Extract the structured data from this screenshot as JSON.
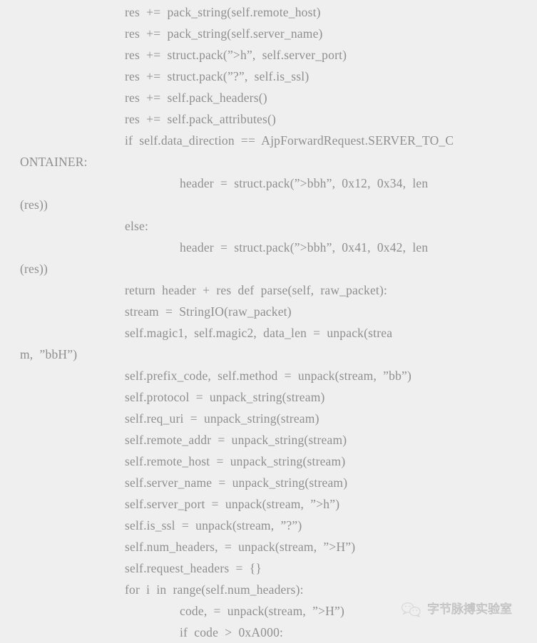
{
  "page": {
    "background_color": "#efefef",
    "text_color": "#8f8f8f",
    "kind": "code-screenshot",
    "language": "python"
  },
  "code": {
    "lines": [
      {
        "indent": 1,
        "text": "res  +=  pack_string(self.remote_host)"
      },
      {
        "indent": 1,
        "text": "res  +=  pack_string(self.server_name)"
      },
      {
        "indent": 1,
        "text": "res  +=  struct.pack(”>h”,  self.server_port)"
      },
      {
        "indent": 1,
        "text": "res  +=  struct.pack(”?”,  self.is_ssl)"
      },
      {
        "indent": 1,
        "text": "res  +=  self.pack_headers()"
      },
      {
        "indent": 1,
        "text": "res  +=  self.pack_attributes()"
      },
      {
        "indent": 1,
        "text": "if  self.data_direction  ==  AjpForwardRequest.SERVER_TO_C"
      },
      {
        "indent": 0,
        "text": "ONTAINER:"
      },
      {
        "indent": 2,
        "text": "header  =  struct.pack(”>bbh”,  0x12,  0x34,  len"
      },
      {
        "indent": 0,
        "text": "(res))"
      },
      {
        "indent": 1,
        "text": "else:"
      },
      {
        "indent": 2,
        "text": "header  =  struct.pack(”>bbh”,  0x41,  0x42,  len"
      },
      {
        "indent": 0,
        "text": "(res))"
      },
      {
        "indent": 1,
        "text": "return  header  +  res  def  parse(self,  raw_packet):"
      },
      {
        "indent": 1,
        "text": "stream  =  StringIO(raw_packet)"
      },
      {
        "indent": 1,
        "text": "self.magic1,  self.magic2,  data_len  =  unpack(strea"
      },
      {
        "indent": 0,
        "text": "m,  ”bbH”)"
      },
      {
        "indent": 1,
        "text": "self.prefix_code,  self.method  =  unpack(stream,  ”bb”)"
      },
      {
        "indent": 1,
        "text": "self.protocol  =  unpack_string(stream)"
      },
      {
        "indent": 1,
        "text": "self.req_uri  =  unpack_string(stream)"
      },
      {
        "indent": 1,
        "text": "self.remote_addr  =  unpack_string(stream)"
      },
      {
        "indent": 1,
        "text": "self.remote_host  =  unpack_string(stream)"
      },
      {
        "indent": 1,
        "text": "self.server_name  =  unpack_string(stream)"
      },
      {
        "indent": 1,
        "text": "self.server_port  =  unpack(stream,  ”>h”)"
      },
      {
        "indent": 1,
        "text": "self.is_ssl  =  unpack(stream,  ”?”)"
      },
      {
        "indent": 1,
        "text": "self.num_headers,  =  unpack(stream,  ”>H”)"
      },
      {
        "indent": 1,
        "text": "self.request_headers  =  {}"
      },
      {
        "indent": 1,
        "text": "for  i  in  range(self.num_headers):"
      },
      {
        "indent": 2,
        "text": "code,  =  unpack(stream,  ”>H”)"
      },
      {
        "indent": 2,
        "text": "if  code  >  0xA000:"
      }
    ]
  },
  "watermark": {
    "icon": "wechat-logo-icon",
    "text": "字节脉搏实验室",
    "color": "#d8d8d8"
  }
}
